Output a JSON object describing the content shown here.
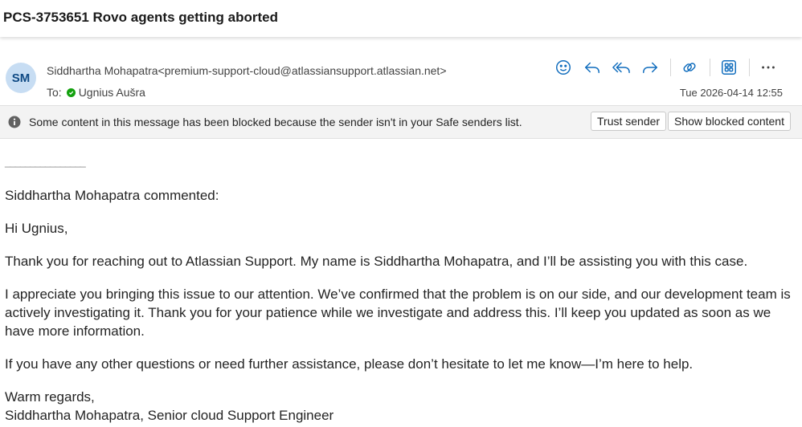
{
  "email": {
    "subject": "PCS-3753651 Rovo agents getting aborted",
    "avatar_initials": "SM",
    "sender_name": "Siddhartha Mohapatra",
    "sender_email": "<premium-support-cloud@atlassiansupport.atlassian.net>",
    "to_label": "To:",
    "recipient": "Ugnius Aušra",
    "date": "Tue 2026-04-14 12:55"
  },
  "toolbar": {
    "icons": [
      "emoji-icon",
      "reply-icon",
      "reply-all-icon",
      "forward-icon",
      "link-icon",
      "apps-icon",
      "more-icon"
    ]
  },
  "banner": {
    "message": "Some content in this message has been blocked because the sender isn't in your Safe senders list.",
    "trust_label": "Trust sender",
    "show_label": "Show blocked content"
  },
  "body": {
    "divider": "________________",
    "commented": "Siddhartha Mohapatra commented:",
    "greeting": "Hi Ugnius,",
    "para1": "Thank you for reaching out to Atlassian Support. My name is Siddhartha Mohapatra, and I’ll be assisting you with this case.",
    "para2": "I appreciate you bringing this issue to our attention. We’ve confirmed that the problem is on our side, and our development team is actively investigating it. Thank you for your patience while we investigate and address this. I’ll keep you updated as soon as we have more information.",
    "para3": "If you have any other questions or need further assistance, please don’t hesitate to let me know—I’m here to help.",
    "closing": "Warm regards,",
    "signature": "Siddhartha Mohapatra, Senior cloud Support Engineer"
  },
  "colors": {
    "accent": "#0f6cbd",
    "avatar_bg": "#c7ddf3",
    "presence": "#13a10e"
  }
}
